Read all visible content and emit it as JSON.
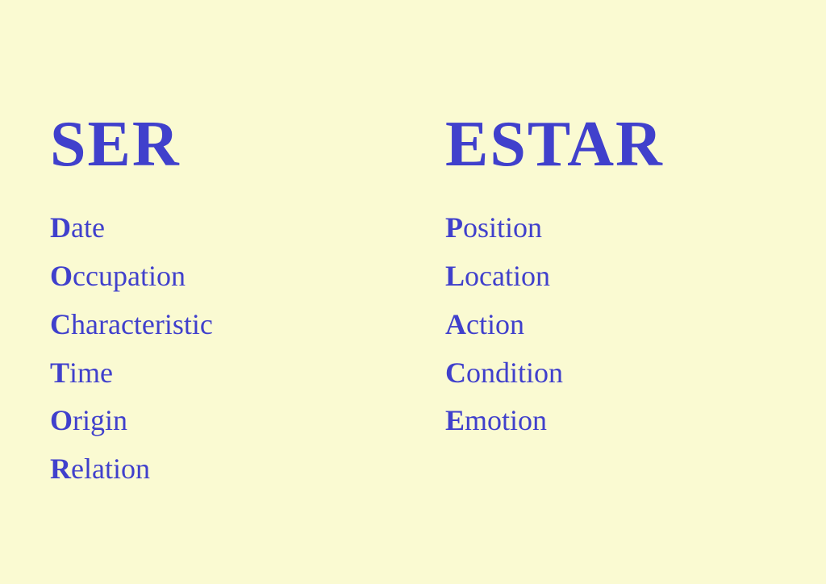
{
  "ser": {
    "title": "SER",
    "items": [
      {
        "first": "D",
        "rest": "ate"
      },
      {
        "first": "O",
        "rest": "ccupation"
      },
      {
        "first": "C",
        "rest": "haracteristic"
      },
      {
        "first": "T",
        "rest": "ime"
      },
      {
        "first": "O",
        "rest": "rigin"
      },
      {
        "first": "R",
        "rest": "elation"
      }
    ]
  },
  "estar": {
    "title": "ESTAR",
    "items": [
      {
        "first": "P",
        "rest": "osition"
      },
      {
        "first": "L",
        "rest": "ocation"
      },
      {
        "first": "A",
        "rest": "ction"
      },
      {
        "first": "C",
        "rest": "ondition"
      },
      {
        "first": "E",
        "rest": "motion"
      }
    ]
  }
}
